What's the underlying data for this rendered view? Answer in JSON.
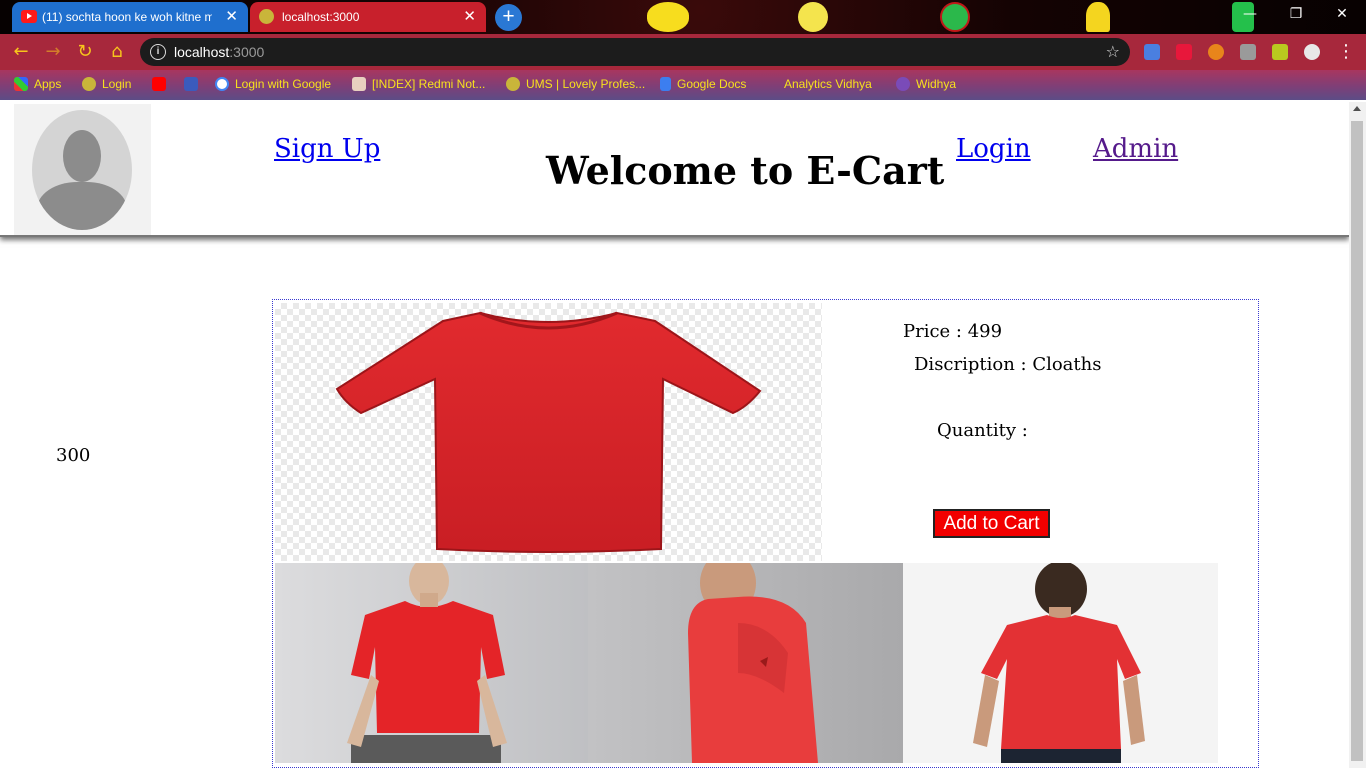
{
  "browser": {
    "tabs": [
      {
        "title": "(11) sochta hoon ke woh kitne m",
        "close": "✕"
      },
      {
        "title": "localhost:3000",
        "close": "✕"
      }
    ],
    "new_tab": "+",
    "window_controls": {
      "minimize": "—",
      "restore": "❐",
      "close": "✕"
    },
    "address": {
      "host": "localhost",
      "port": ":3000"
    },
    "bookmarks": [
      {
        "label": "Apps"
      },
      {
        "label": "Login"
      },
      {
        "label": ""
      },
      {
        "label": ""
      },
      {
        "label": "Login with Google"
      },
      {
        "label": "[INDEX] Redmi Not..."
      },
      {
        "label": "UMS | Lovely Profes..."
      },
      {
        "label": "Google Docs"
      },
      {
        "label": "Analytics Vidhya"
      },
      {
        "label": "Widhya"
      }
    ]
  },
  "header": {
    "signup": "Sign Up",
    "title": "Welcome to E-Cart",
    "login": "Login",
    "admin": "Admin"
  },
  "sidebar": {
    "value": "300"
  },
  "product": {
    "price_label": "Price : 499",
    "description_label": "Discription : Cloaths",
    "quantity_label": "Quantity :",
    "add_to_cart": "Add to Cart",
    "color": "#d9232a"
  }
}
